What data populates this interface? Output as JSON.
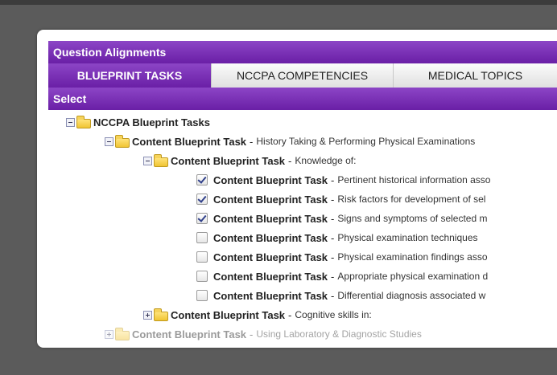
{
  "panel": {
    "title": "Question Alignments",
    "select_label": "Select"
  },
  "tabs": [
    {
      "label": "BLUEPRINT TASKS",
      "active": true
    },
    {
      "label": "NCCPA COMPETENCIES",
      "active": false
    },
    {
      "label": "MEDICAL TOPICS",
      "active": false
    }
  ],
  "tree": {
    "root": {
      "label": "NCCPA Blueprint Tasks"
    },
    "level1": {
      "label": "Content Blueprint Task",
      "dash": "-",
      "desc": "History Taking & Performing Physical Examinations"
    },
    "level2": {
      "label": "Content Blueprint Task",
      "dash": "-",
      "desc": "Knowledge of:"
    },
    "items": [
      {
        "label": "Content Blueprint Task",
        "dash": "-",
        "desc": "Pertinent historical information asso",
        "checked": true
      },
      {
        "label": "Content Blueprint Task",
        "dash": "-",
        "desc": "Risk factors for development of sel",
        "checked": true
      },
      {
        "label": "Content Blueprint Task",
        "dash": "-",
        "desc": "Signs and symptoms of selected m",
        "checked": true
      },
      {
        "label": "Content Blueprint Task",
        "dash": "-",
        "desc": "Physical examination techniques",
        "checked": false
      },
      {
        "label": "Content Blueprint Task",
        "dash": "-",
        "desc": "Physical examination findings asso",
        "checked": false
      },
      {
        "label": "Content Blueprint Task",
        "dash": "-",
        "desc": "Appropriate physical examination d",
        "checked": false
      },
      {
        "label": "Content Blueprint Task",
        "dash": "-",
        "desc": "Differential diagnosis associated w",
        "checked": false
      }
    ],
    "level2b": {
      "label": "Content Blueprint Task",
      "dash": "-",
      "desc": "Cognitive skills in:"
    },
    "level1b": {
      "label": "Content Blueprint Task",
      "dash": "-",
      "desc": "Using Laboratory & Diagnostic Studies"
    }
  },
  "colors": {
    "accent": "#7a2fb8",
    "background": "#5b5b5b"
  }
}
